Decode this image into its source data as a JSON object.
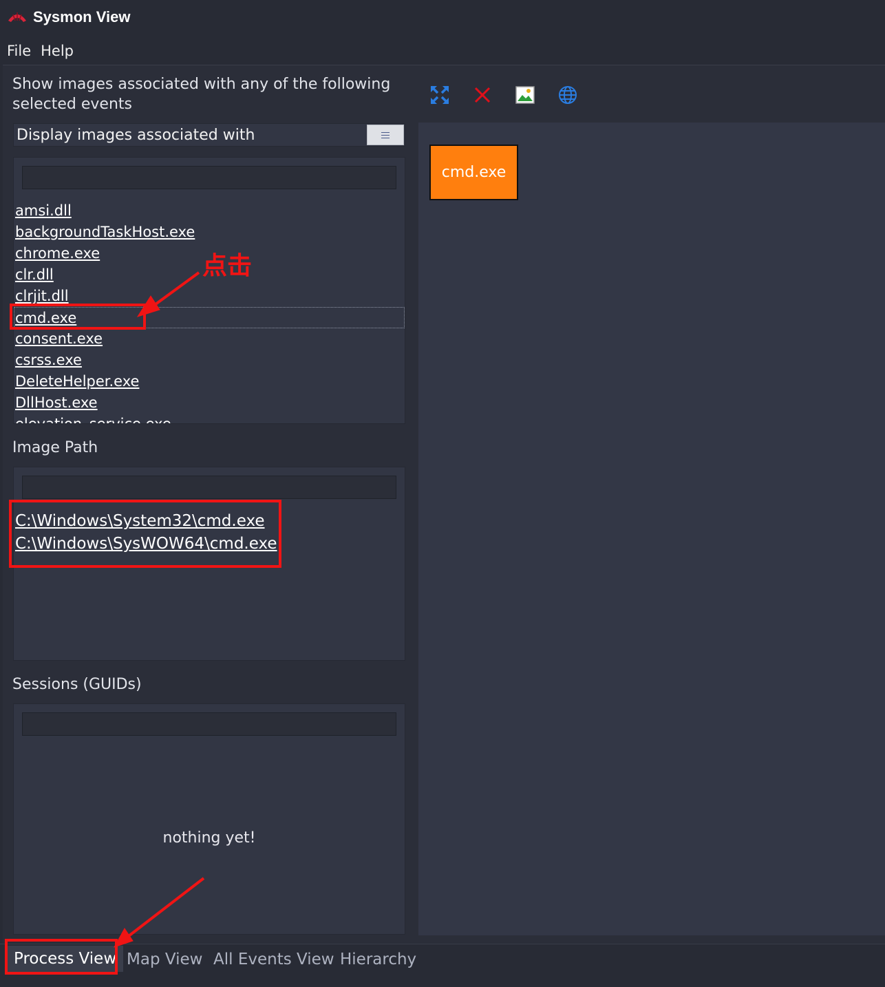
{
  "window": {
    "title": "Sysmon View"
  },
  "menu": {
    "items": [
      "File",
      "Help"
    ]
  },
  "left": {
    "heading": "Show images associated with any of the following selected events",
    "dropdown_value": "Display images associated with",
    "images": [
      "amsi.dll",
      "backgroundTaskHost.exe",
      "chrome.exe",
      "clr.dll",
      "clrjit.dll",
      "cmd.exe",
      "consent.exe",
      "csrss.exe",
      "DeleteHelper.exe",
      "DllHost.exe",
      "elevation_service.exe"
    ],
    "selected_image": "cmd.exe",
    "image_path_label": "Image Path",
    "image_paths": [
      "C:\\Windows\\System32\\cmd.exe",
      "C:\\Windows\\SysWOW64\\cmd.exe"
    ],
    "sessions_label": "Sessions (GUIDs)",
    "sessions_placeholder": "nothing yet!"
  },
  "toolbar": {
    "icons": [
      "fit-expand-icon",
      "clear-x-icon",
      "export-image-icon",
      "globe-icon"
    ]
  },
  "canvas": {
    "node_label": "cmd.exe",
    "node_color": "#ff7f0e"
  },
  "tabs": [
    "Process View",
    "Map View",
    "All Events View",
    "Hierarchy"
  ],
  "active_tab": "Process View",
  "annotation": {
    "text": "点击",
    "color": "#f01414"
  }
}
